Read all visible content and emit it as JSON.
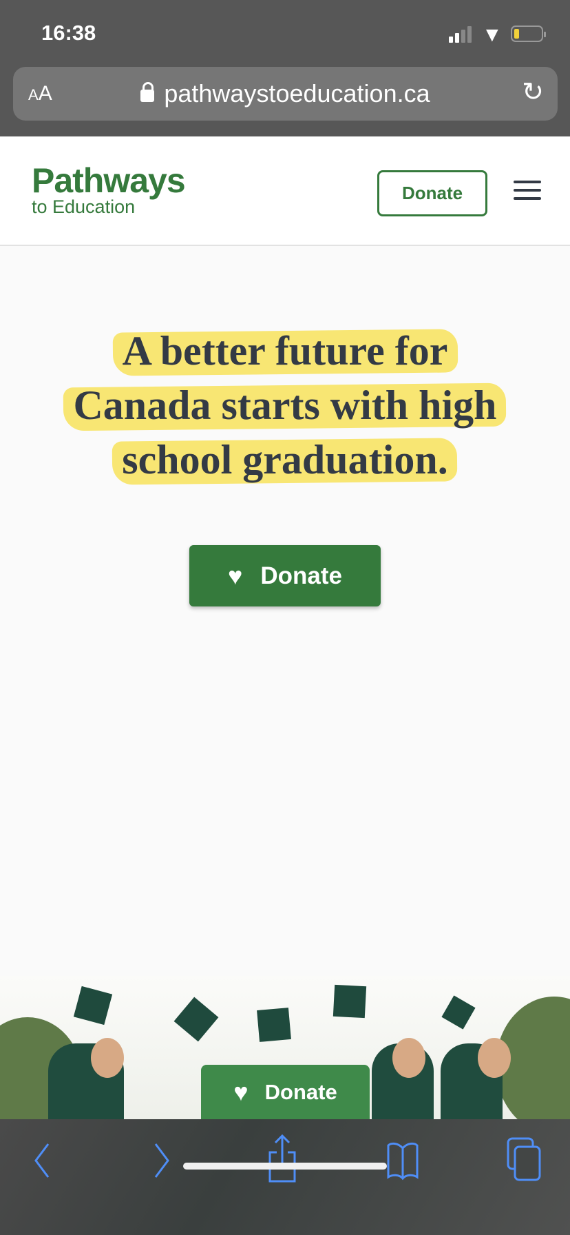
{
  "status_bar": {
    "time": "16:38",
    "battery_color": "#f3d23a"
  },
  "browser": {
    "text_size_label_small": "A",
    "text_size_label_large": "A",
    "url": "pathwaystoeducation.ca"
  },
  "header": {
    "logo_main": "Pathways",
    "logo_sub": "to Education",
    "donate_label": "Donate",
    "brand_color": "#357a3c"
  },
  "hero": {
    "headline_lines": [
      "A better future for",
      "Canada starts with high",
      "school graduation."
    ],
    "highlight_color": "#f8e673",
    "donate_label": "Donate"
  },
  "sticky": {
    "donate_label": "Donate"
  },
  "toolbar": {
    "icons": [
      "back-icon",
      "forward-icon",
      "share-icon",
      "bookmarks-icon",
      "tabs-icon"
    ],
    "icon_color": "#4f8ef7"
  }
}
